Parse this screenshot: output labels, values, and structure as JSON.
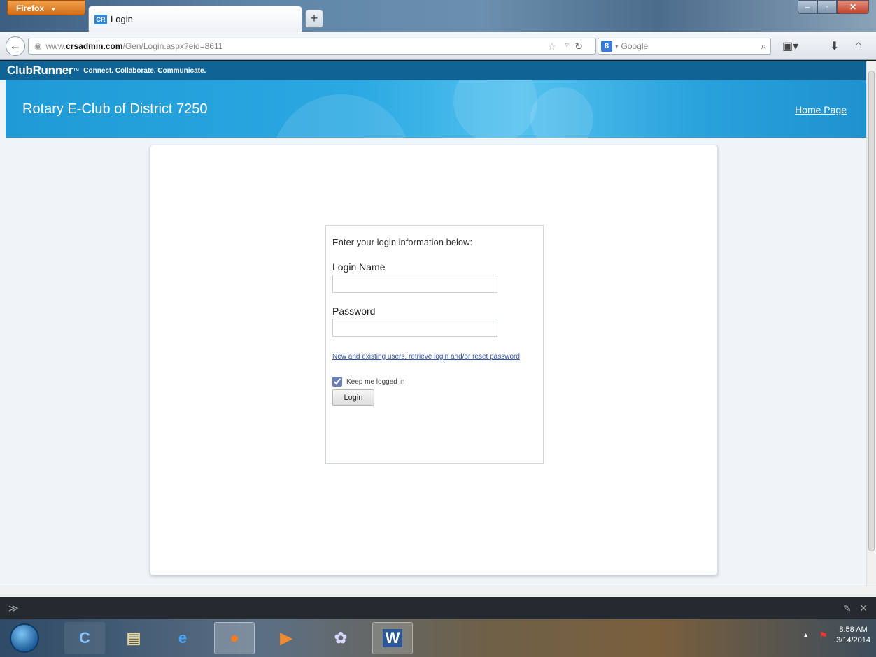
{
  "browser": {
    "menu_label": "Firefox",
    "menu_arrow": "▼",
    "tab_title": "Login",
    "tab_favicon_text": "CR",
    "new_tab_glyph": "+",
    "url_prefix": "www.",
    "url_host": "crsadmin.com",
    "url_path": "/Gen/Login.aspx?eid=8611",
    "search_engine": "Google"
  },
  "site": {
    "brand": "ClubRunner",
    "brand_tm": "™",
    "tagline": "Connect. Collaborate. Communicate.",
    "club_name": "Rotary E-Club of District 7250",
    "home_link": "Home Page"
  },
  "login": {
    "intro": "Enter your login information below:",
    "name_label": "Login Name",
    "name_value": "",
    "password_label": "Password",
    "password_value": "",
    "retrieve_link": "New and existing users, retrieve login and/or reset password",
    "keep_label": "Keep me logged in",
    "keep_checked": true,
    "button_label": "Login"
  },
  "taskbar": {
    "time": "8:58 AM",
    "date": "3/14/2014"
  },
  "icons": [
    "back-arrow-icon",
    "globe-icon",
    "bookmark-star-icon",
    "reload-icon",
    "google-icon",
    "search-icon",
    "bookmarks-icon",
    "download-icon",
    "home-icon",
    "windows-start-icon",
    "flag-icon"
  ]
}
